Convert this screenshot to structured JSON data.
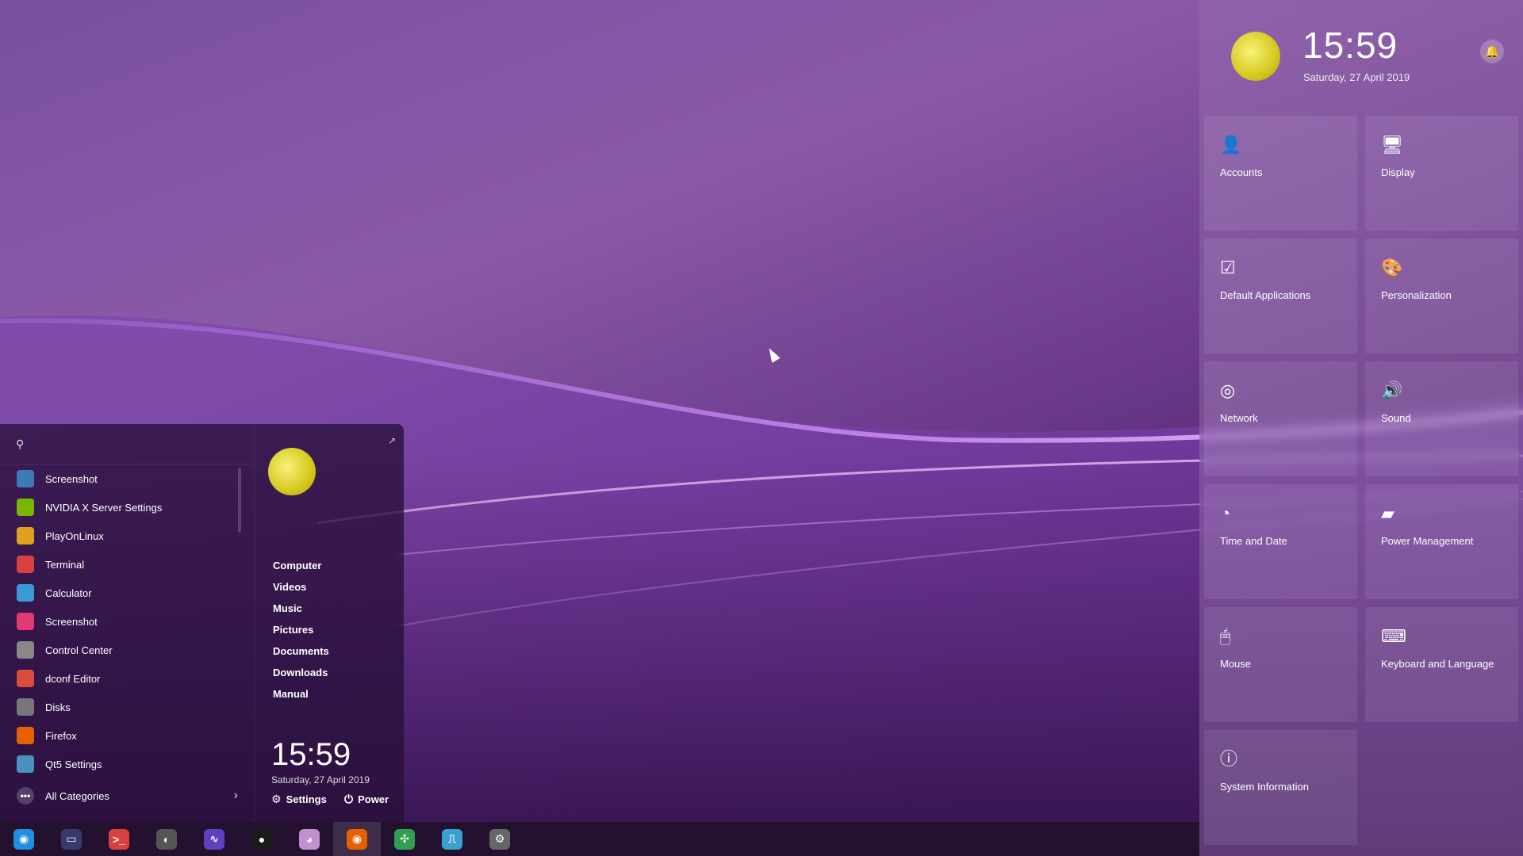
{
  "start_menu": {
    "search_placeholder": "",
    "apps": [
      {
        "label": "Screenshot",
        "icon": "screenshot-icon",
        "color": "#3d7ab8"
      },
      {
        "label": "NVIDIA X Server Settings",
        "icon": "nvidia-icon",
        "color": "#76b900"
      },
      {
        "label": "PlayOnLinux",
        "icon": "playonlinux-icon",
        "color": "#e0a020"
      },
      {
        "label": "Terminal",
        "icon": "terminal-icon",
        "color": "#d94040"
      },
      {
        "label": "Calculator",
        "icon": "calculator-icon",
        "color": "#3a9ad9"
      },
      {
        "label": "Screenshot",
        "icon": "crop-icon",
        "color": "#e03a70"
      },
      {
        "label": "Control Center",
        "icon": "gear-icon",
        "color": "#888888"
      },
      {
        "label": "dconf Editor",
        "icon": "dconf-icon",
        "color": "#d94b3b"
      },
      {
        "label": "Disks",
        "icon": "disk-icon",
        "color": "#777777"
      },
      {
        "label": "Firefox",
        "icon": "firefox-icon",
        "color": "#e66000"
      },
      {
        "label": "Qt5 Settings",
        "icon": "qt-settings-icon",
        "color": "#4a90c0"
      }
    ],
    "all_categories": "All Categories",
    "places": [
      "Computer",
      "Videos",
      "Music",
      "Pictures",
      "Documents",
      "Downloads",
      "Manual"
    ],
    "clock": "15:59",
    "date": "Saturday, 27 April 2019",
    "settings_label": "Settings",
    "power_label": "Power"
  },
  "control_center": {
    "clock": "15:59",
    "date": "Saturday, 27 April 2019",
    "tiles": [
      {
        "label": "Accounts",
        "icon": "user-icon",
        "glyph": "👤"
      },
      {
        "label": "Display",
        "icon": "display-icon",
        "glyph": "🖥"
      },
      {
        "label": "Default Applications",
        "icon": "default-apps-icon",
        "glyph": "☑"
      },
      {
        "label": "Personalization",
        "icon": "palette-icon",
        "glyph": "🎨"
      },
      {
        "label": "Network",
        "icon": "network-icon",
        "glyph": "◎"
      },
      {
        "label": "Sound",
        "icon": "speaker-icon",
        "glyph": "🔊"
      },
      {
        "label": "Time and Date",
        "icon": "clock-icon",
        "glyph": "◔"
      },
      {
        "label": "Power Management",
        "icon": "battery-icon",
        "glyph": "▰"
      },
      {
        "label": "Mouse",
        "icon": "mouse-icon",
        "glyph": "🖱"
      },
      {
        "label": "Keyboard and Language",
        "icon": "keyboard-icon",
        "glyph": "⌨"
      },
      {
        "label": "System Information",
        "icon": "info-icon",
        "glyph": "ⓘ"
      }
    ]
  },
  "taskbar": {
    "apps": [
      {
        "name": "launcher-icon",
        "color": "#1f8fe0",
        "glyph": "◉"
      },
      {
        "name": "desktop-icon",
        "color": "#3a3a6a",
        "glyph": "▭"
      },
      {
        "name": "terminal-icon",
        "color": "#d94040",
        "glyph": ">_"
      },
      {
        "name": "steam-icon",
        "color": "#555555",
        "glyph": "◐"
      },
      {
        "name": "monitor-icon",
        "color": "#6040c0",
        "glyph": "∿"
      },
      {
        "name": "camera-icon",
        "color": "#1a1a1a",
        "glyph": "●"
      },
      {
        "name": "color-picker-icon",
        "color": "#c090d0",
        "glyph": "◕"
      },
      {
        "name": "firefox-icon",
        "color": "#e66000",
        "glyph": "◉"
      },
      {
        "name": "playonlinux-icon",
        "color": "#30a050",
        "glyph": "✣"
      },
      {
        "name": "system-monitor-icon",
        "color": "#3aa0d0",
        "glyph": "⎍"
      },
      {
        "name": "settings-icon",
        "color": "#666666",
        "glyph": "⚙"
      }
    ],
    "active_index": 7
  }
}
